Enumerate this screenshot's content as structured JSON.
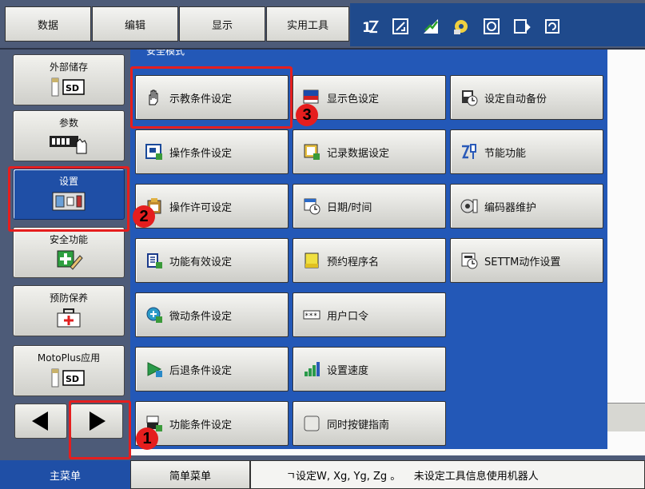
{
  "top_menu": {
    "tabs": [
      "数据",
      "编辑",
      "显示",
      "实用工具"
    ],
    "tool_icons": [
      "tool-coord-icon",
      "tool-edit-icon",
      "tool-chart-icon",
      "tool-gear-icon",
      "tool-grid-icon",
      "tool-export-icon",
      "tool-cycle-icon"
    ]
  },
  "side_menu": {
    "items": [
      {
        "label": "外部储存",
        "icon": "sd-card-icon"
      },
      {
        "label": "参数",
        "icon": "parameter-icon"
      },
      {
        "label": "设置",
        "icon": "settings-panel-icon"
      },
      {
        "label": "安全功能",
        "icon": "safety-function-icon"
      },
      {
        "label": "预防保养",
        "icon": "maintenance-kit-icon"
      },
      {
        "label": "MotoPlus应用",
        "icon": "sd-card-icon"
      }
    ],
    "active": "设置"
  },
  "main": {
    "section_title": "安全模式",
    "columns": [
      [
        "示教条件设定",
        "操作条件设定",
        "操作许可设定",
        "功能有效设定",
        "微动条件设定",
        "后退条件设定",
        "功能条件设定"
      ],
      [
        "显示色设定",
        "记录数据设定",
        "日期/时间",
        "预约程序名",
        "用户口令",
        "设置速度",
        "同时按键指南"
      ],
      [
        "设定自动备份",
        "节能功能",
        "编码器维护",
        "SETTM动作设置"
      ]
    ]
  },
  "bottom": {
    "main_menu": "主菜单",
    "simple_menu": "简单菜单",
    "status": "ㄱ设定W, Xg, Yg, Zg 。    未设定工具信息使用机器人"
  },
  "annotations": {
    "badges": [
      "1",
      "2",
      "3"
    ]
  },
  "colors": {
    "accent_blue": "#2358b7",
    "active_blue": "#1f4fa6",
    "frame": "#4d5b78",
    "annotation_red": "#e51e1e"
  }
}
